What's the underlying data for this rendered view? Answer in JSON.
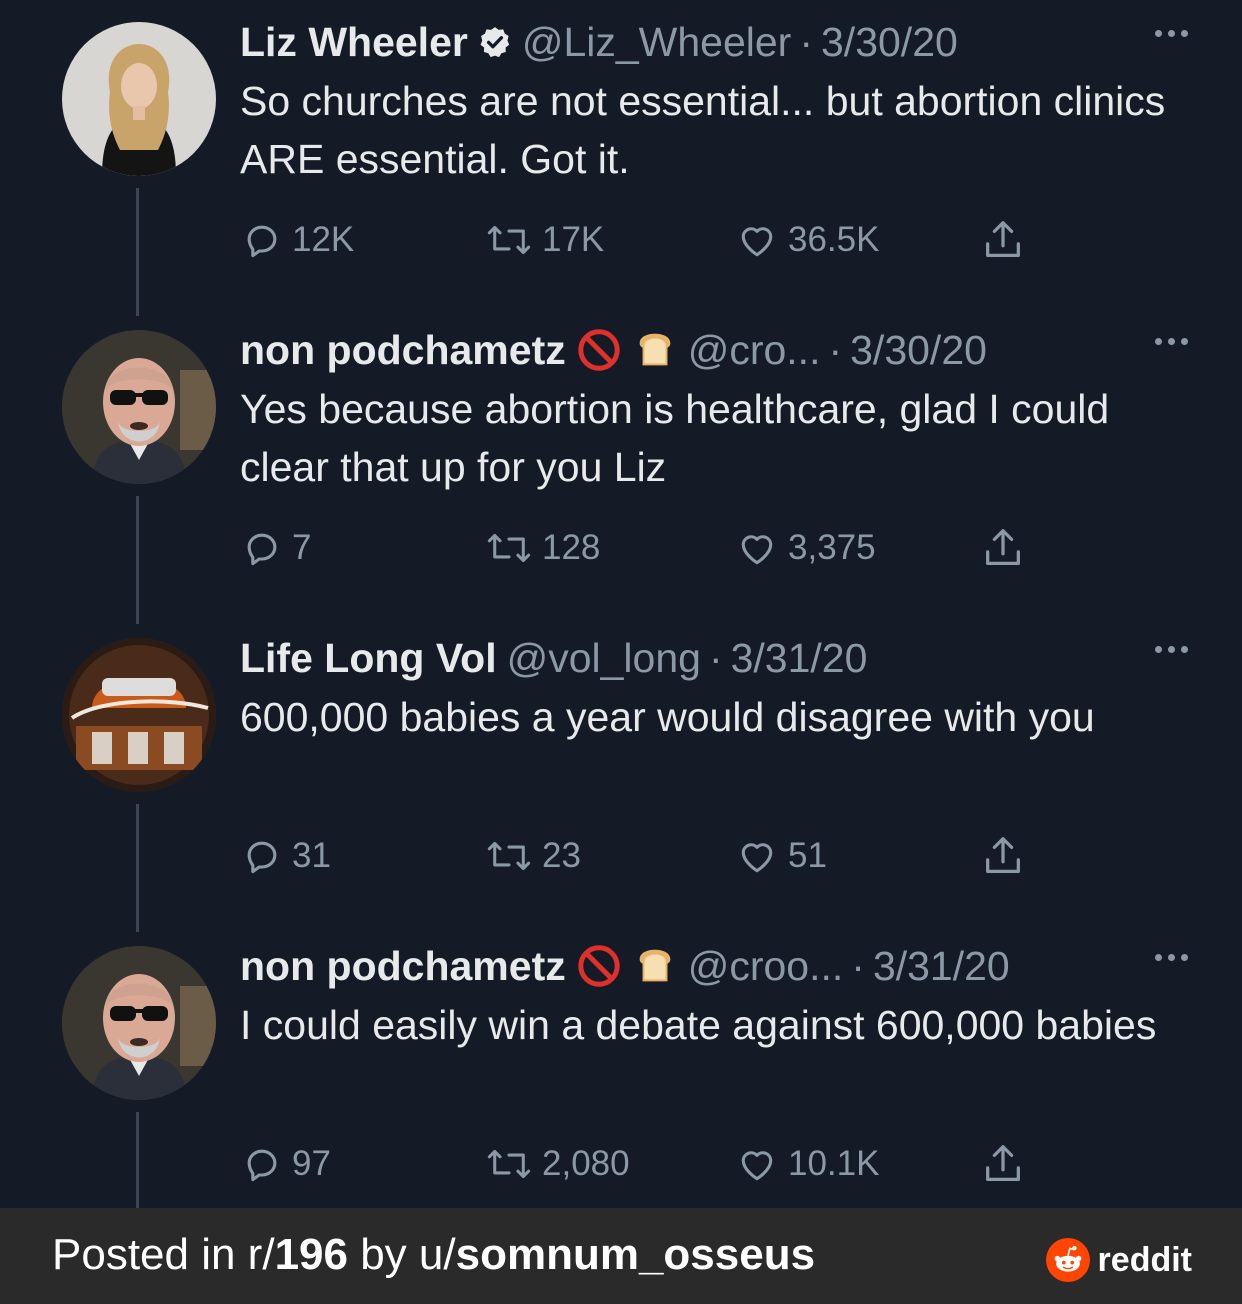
{
  "tweets": [
    {
      "name": "Liz Wheeler",
      "verified": true,
      "handle": "@Liz_Wheeler",
      "date": "3/30/20",
      "text": "So churches are not essential... but abortion clinics ARE essential. Got it.",
      "replies": "12K",
      "retweets": "17K",
      "likes": "36.5K"
    },
    {
      "name": "non podchametz",
      "emoji": "🚫🍞",
      "handle": "@cro...",
      "date": "3/30/20",
      "text": "Yes because abortion is healthcare, glad I could clear that up for you Liz",
      "replies": "7",
      "retweets": "128",
      "likes": "3,375"
    },
    {
      "name": "Life Long Vol",
      "handle": "@vol_long",
      "date": "3/31/20",
      "text": "600,000 babies a year would disagree with you",
      "replies": "31",
      "retweets": "23",
      "likes": "51"
    },
    {
      "name": "non podchametz",
      "emoji": "🚫🍞",
      "handle": "@croo...",
      "date": "3/31/20",
      "text": "I could easily win a debate against 600,000 babies",
      "replies": "97",
      "retweets": "2,080",
      "likes": "10.1K"
    }
  ],
  "footer": {
    "prefix": "Posted in r/",
    "subreddit": "196",
    "by": " by u/",
    "username": "somnum_osseus",
    "brand": "reddit"
  },
  "colors": {
    "background": "#151b26",
    "muted": "#8b98a5",
    "footer_bg": "#2a2a2a",
    "reddit_orange": "#ff4500"
  },
  "icons": [
    "reply-icon",
    "retweet-icon",
    "like-icon",
    "share-icon",
    "verified-icon",
    "more-icon",
    "reddit-icon"
  ]
}
